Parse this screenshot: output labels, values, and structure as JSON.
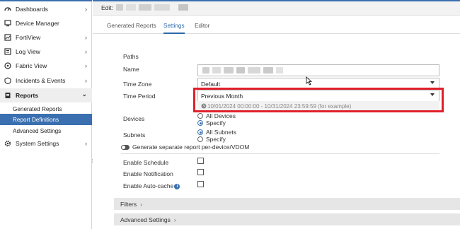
{
  "sidebar": {
    "items": [
      {
        "label": "Dashboards",
        "icon": "dashboard-icon",
        "chevron": "›"
      },
      {
        "label": "Device Manager",
        "icon": "device-manager-icon",
        "chevron": ""
      },
      {
        "label": "FortiView",
        "icon": "fortiview-icon",
        "chevron": "›"
      },
      {
        "label": "Log View",
        "icon": "log-view-icon",
        "chevron": "›"
      },
      {
        "label": "Fabric View",
        "icon": "fabric-view-icon",
        "chevron": "›"
      },
      {
        "label": "Incidents & Events",
        "icon": "incidents-icon",
        "chevron": "›"
      },
      {
        "label": "Reports",
        "icon": "reports-icon",
        "chevron": "⌄"
      }
    ],
    "sub_items": [
      "Generated Reports",
      "Report Definitions",
      "Advanced Settings"
    ],
    "system_settings": {
      "label": "System Settings",
      "icon": "gear-icon",
      "chevron": "›"
    }
  },
  "header": {
    "edit_label": "Edit:"
  },
  "tabs": [
    "Generated Reports",
    "Settings",
    "Editor"
  ],
  "form": {
    "paths_label": "Paths",
    "name_label": "Name",
    "time_zone_label": "Time Zone",
    "time_zone_value": "Default",
    "time_period_label": "Time Period",
    "time_period_value": "Previous Month",
    "time_period_example": "10/01/2024 00:00:00 - 10/31/2024 23:59:59 (for example)",
    "devices_label": "Devices",
    "devices_options": [
      "All Devices",
      "Specify"
    ],
    "devices_selected": "Specify",
    "subnets_label": "Subnets",
    "subnets_options": [
      "All Subnets",
      "Specify"
    ],
    "subnets_selected": "All Subnets",
    "toggle_label": "Generate separate report per-device/VDOM",
    "enable_schedule_label": "Enable Schedule",
    "enable_notification_label": "Enable Notification",
    "enable_autocache_label": "Enable Auto-cache"
  },
  "sections": {
    "filters": "Filters",
    "advanced": "Advanced Settings"
  },
  "colors": {
    "accent": "#3a6fb0",
    "highlight": "#e0202a"
  }
}
